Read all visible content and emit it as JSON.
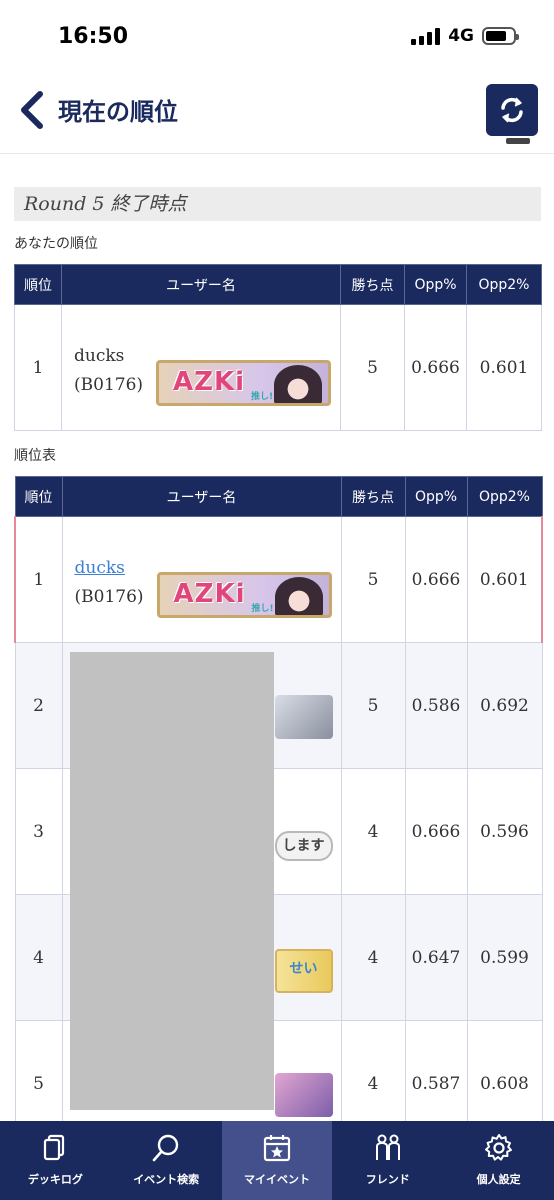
{
  "status_bar": {
    "time": "16:50",
    "network": "4G"
  },
  "header": {
    "title": "現在の順位"
  },
  "round": {
    "label": "Round 5 終了時点"
  },
  "my_rank": {
    "section_label": "あなたの順位",
    "columns": [
      "順位",
      "ユーザー名",
      "勝ち点",
      "Opp%",
      "Opp2%"
    ],
    "row": {
      "rank": "1",
      "name": "ducks",
      "id": "(B0176)",
      "banner_text": "AZKi",
      "banner_tag": "推し!",
      "points": "5",
      "opp": "0.666",
      "opp2": "0.601"
    }
  },
  "standings": {
    "section_label": "順位表",
    "columns": [
      "順位",
      "ユーザー名",
      "勝ち点",
      "Opp%",
      "Opp2%"
    ],
    "rows": [
      {
        "rank": "1",
        "name": "ducks",
        "id": "(B0176)",
        "banner_text": "AZKi",
        "banner_tag": "推し!",
        "points": "5",
        "opp": "0.666",
        "opp2": "0.601"
      },
      {
        "rank": "2",
        "points": "5",
        "opp": "0.586",
        "opp2": "0.692"
      },
      {
        "rank": "3",
        "banner_text": "します",
        "points": "4",
        "opp": "0.666",
        "opp2": "0.596"
      },
      {
        "rank": "4",
        "banner_text": "せい",
        "points": "4",
        "opp": "0.647",
        "opp2": "0.599"
      },
      {
        "rank": "5",
        "points": "4",
        "opp": "0.587",
        "opp2": "0.608"
      }
    ]
  },
  "nav": {
    "items": [
      {
        "label": "デッキログ",
        "icon": "cards-icon"
      },
      {
        "label": "イベント検索",
        "icon": "search-icon"
      },
      {
        "label": "マイイベント",
        "icon": "calendar-star-icon",
        "active": true
      },
      {
        "label": "フレンド",
        "icon": "friends-icon"
      },
      {
        "label": "個人設定",
        "icon": "gear-icon"
      }
    ]
  },
  "colors": {
    "navy": "#1b2a5e",
    "highlight": "#e38a96",
    "link": "#3d7fd4",
    "nav_active": "#43508b"
  }
}
